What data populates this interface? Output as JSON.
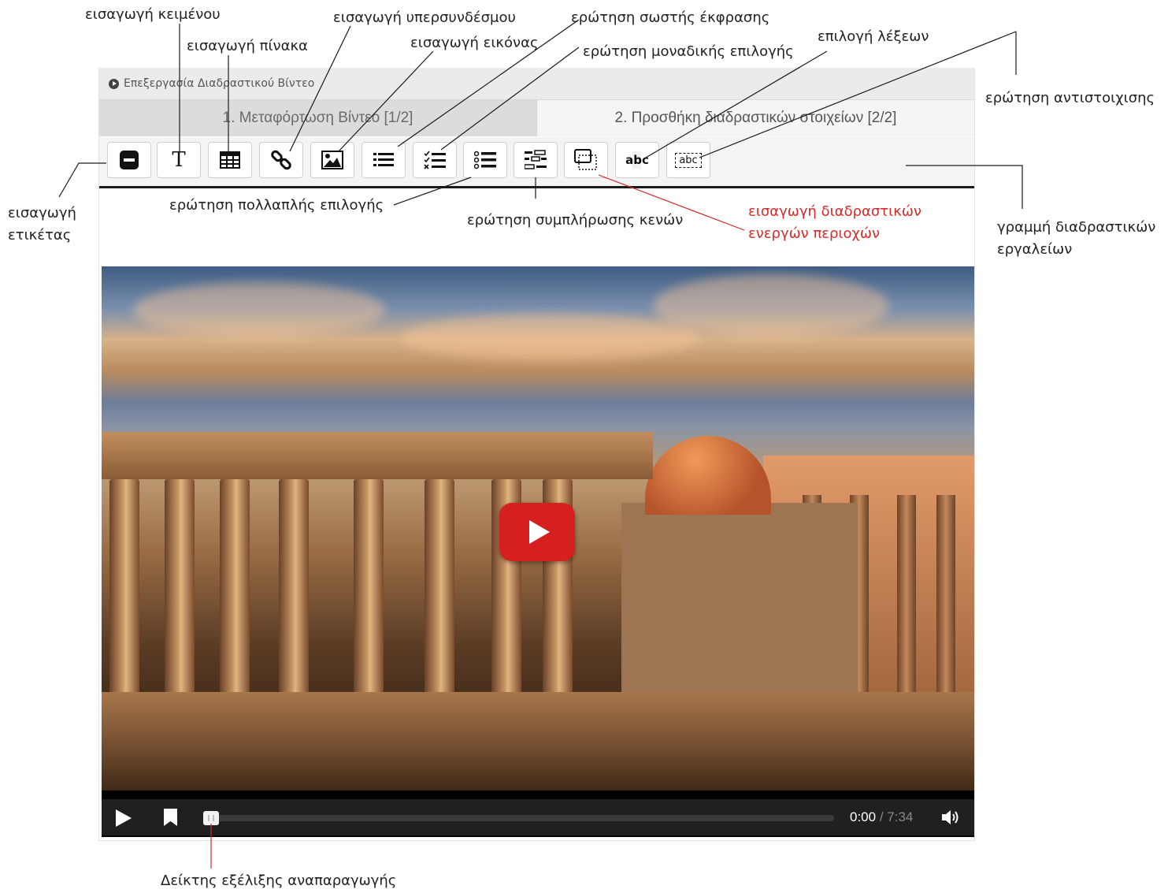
{
  "editor": {
    "panel_title": "Επεξεργασία Διαδραστικού Βίντεο",
    "tabs": [
      {
        "label": "1. Μεταφόρτωση Βίντεο [1/2]",
        "active": false
      },
      {
        "label": "2. Προσθήκη διαδραστικών στοιχείων [2/2]",
        "active": true
      }
    ],
    "toolbar": [
      {
        "name": "label-tool",
        "icon": "label-minus-icon"
      },
      {
        "name": "text-tool",
        "icon": "text-T-icon",
        "glyph": "T"
      },
      {
        "name": "table-tool",
        "icon": "table-icon"
      },
      {
        "name": "link-tool",
        "icon": "link-icon"
      },
      {
        "name": "image-tool",
        "icon": "image-icon"
      },
      {
        "name": "single-choice-tool",
        "icon": "list-icon"
      },
      {
        "name": "multi-choice-tool",
        "icon": "checklist-icon"
      },
      {
        "name": "mark-words-tool",
        "icon": "bullet-list-icon"
      },
      {
        "name": "fill-blanks-tool",
        "icon": "blanks-icon"
      },
      {
        "name": "hotspot-tool",
        "icon": "hotspot-icon"
      },
      {
        "name": "word-selection-tool",
        "icon": "abc-select-icon",
        "glyph": "abc"
      },
      {
        "name": "drag-text-tool",
        "icon": "abc-drag-icon",
        "glyph": "abc"
      }
    ],
    "colors": {
      "panel": "#ebebeb",
      "tab_inactive": "#dcdcdc",
      "toolbar_border": "#1b1b1b",
      "play_red": "#d61f1f"
    }
  },
  "player": {
    "current_time": "0:00",
    "separator": " / ",
    "duration": "7:34",
    "progress": 0.0
  },
  "annotations": {
    "insert_text": "εισαγωγή κειμένου",
    "insert_table": "εισαγωγή πίνακα",
    "insert_link": "εισαγωγή υπερσυνδέσμου",
    "insert_image": "εισαγωγή εικόνας",
    "correct_expression": "ερώτηση σωστής έκφρασης",
    "single_choice": "ερώτηση μοναδικής επιλογής",
    "word_selection": "επιλογή λέξεων",
    "matching_question": "ερώτηση αντιστοιχισης",
    "insert_label_line1": "εισαγωγή",
    "insert_label_line2": "ετικέτας",
    "multiple_choice": "ερώτηση πολλαπλής επιλογής",
    "fill_blanks": "ερώτηση συμπλήρωσης κενών",
    "hotspots_line1": "εισαγωγή διαδραστικών",
    "hotspots_line2": "ενεργών περιοχών",
    "toolbar_line1": "γραμμή διαδραστικών",
    "toolbar_line2": "εργαλείων",
    "progress_indicator": "Δείκτης εξέλιξης αναπαραγωγής"
  }
}
